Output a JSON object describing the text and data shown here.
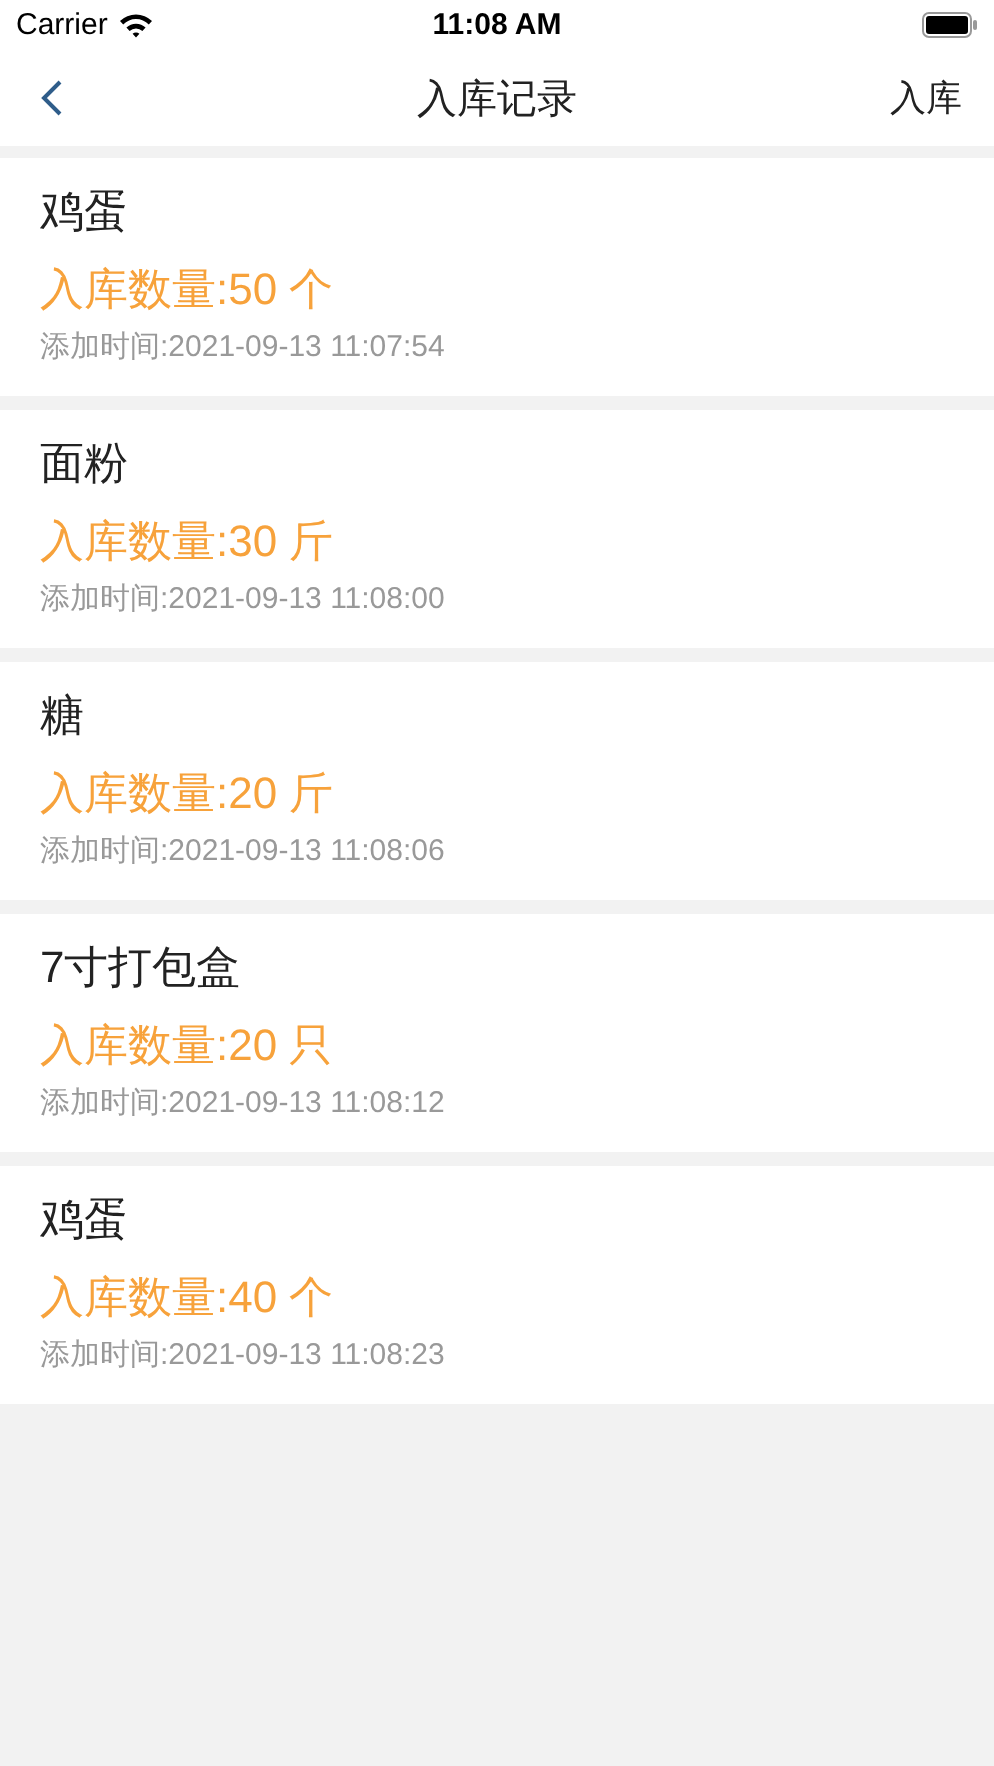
{
  "status_bar": {
    "carrier": "Carrier",
    "time": "11:08 AM"
  },
  "nav": {
    "title": "入库记录",
    "action": "入库"
  },
  "records": [
    {
      "name": "鸡蛋",
      "quantity": "入库数量:50 个",
      "added": "添加时间:2021-09-13 11:07:54"
    },
    {
      "name": "面粉",
      "quantity": "入库数量:30 斤",
      "added": "添加时间:2021-09-13 11:08:00"
    },
    {
      "name": "糖",
      "quantity": "入库数量:20 斤",
      "added": "添加时间:2021-09-13 11:08:06"
    },
    {
      "name": "7寸打包盒",
      "quantity": "入库数量:20 只",
      "added": "添加时间:2021-09-13 11:08:12"
    },
    {
      "name": "鸡蛋",
      "quantity": "入库数量:40 个",
      "added": "添加时间:2021-09-13 11:08:23"
    }
  ]
}
